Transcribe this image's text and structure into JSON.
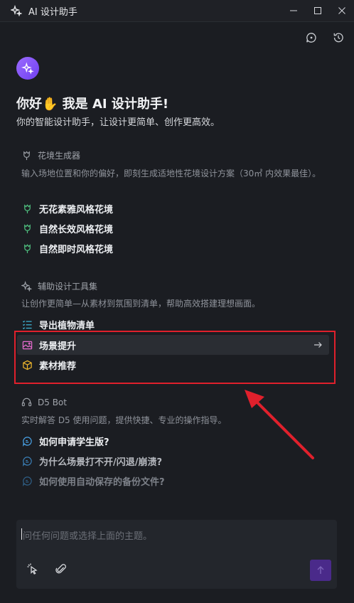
{
  "window": {
    "title": "AI 设计助手"
  },
  "greeting": {
    "title": "你好✋ 我是 AI 设计助手!",
    "subtitle": "你的智能设计助手，让设计更简单、创作更高效。"
  },
  "sections": [
    {
      "title": "花境生成器",
      "description": "输入场地位置和你的偏好，即刻生成适地性花境设计方案（30㎡ 内效果最佳）。",
      "items": [
        {
          "label": "无花素雅风格花境"
        },
        {
          "label": "自然长效风格花境"
        },
        {
          "label": "自然即时风格花境"
        }
      ]
    },
    {
      "title": "辅助设计工具集",
      "description": "让创作更简单—从素材到氛围到清单，帮助高效搭建理想画面。",
      "items": [
        {
          "label": "导出植物清单"
        },
        {
          "label": "场景提升"
        },
        {
          "label": "素材推荐"
        }
      ]
    },
    {
      "title": "D5 Bot",
      "description": "实时解答 D5 使用问题，提供快捷、专业的操作指导。",
      "items": [
        {
          "label": "如何申请学生版?"
        },
        {
          "label": "为什么场景打不开/闪退/崩溃?"
        },
        {
          "label": "如何使用自动保存的备份文件?"
        }
      ]
    }
  ],
  "input": {
    "placeholder": "问任何问题或选择上面的主题。"
  },
  "colors": {
    "accent": "#8b5cf6",
    "highlight": "#e0202c"
  }
}
